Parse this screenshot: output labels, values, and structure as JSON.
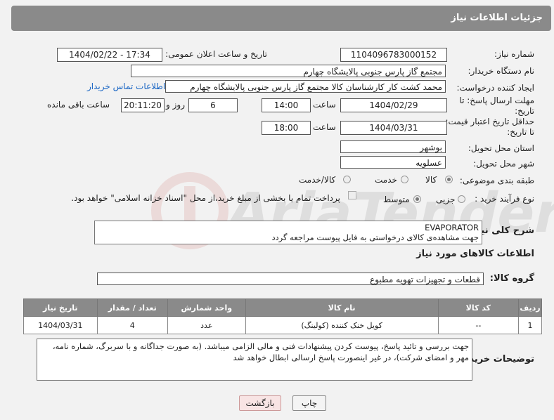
{
  "header": {
    "title": "جزئیات اطلاعات نیاز"
  },
  "fields": {
    "need_number_label": "شماره نیاز:",
    "need_number": "1104096783000152",
    "announce_label": "تاریخ و ساعت اعلان عمومی:",
    "announce_value": "1404/02/22 - 17:34",
    "buyer_org_label": "نام دستگاه خریدار:",
    "buyer_org": "مجتمع گاز پارس جنوبی  پالایشگاه چهارم",
    "requester_label": "ایجاد کننده درخواست:",
    "requester": "محمد کشت کار کارشناسان کالا مجتمع گاز پارس جنوبی  پالایشگاه چهارم",
    "contact_link": "اطلاعات تماس خریدار",
    "reply_deadline_label": "مهلت ارسال پاسخ: تا تاریخ:",
    "reply_date": "1404/02/29",
    "time_label": "ساعت",
    "reply_time": "14:00",
    "days": "6",
    "days_label": "روز و",
    "remaining": "20:11:20",
    "remaining_label": "ساعت باقی مانده",
    "price_validity_label": "حداقل تاریخ اعتبار قیمت: تا تاریخ:",
    "validity_date": "1404/03/31",
    "validity_time": "18:00",
    "province_label": "استان محل تحویل:",
    "province": "بوشهر",
    "city_label": "شهر محل تحویل:",
    "city": "عسلویه",
    "category_label": "طبقه بندی موضوعی:",
    "category_options": [
      "کالا",
      "خدمت",
      "کالا/خدمت"
    ],
    "purchase_type_label": "نوع فرآیند خرید :",
    "purchase_options": [
      "جزیی",
      "متوسط"
    ],
    "payment_note": "پرداخت تمام یا بخشی از مبلغ خرید،از محل \"اسناد خزانه اسلامی\" خواهد بود."
  },
  "description": {
    "label": "شرح کلی نیاز:",
    "line1": "EVAPORATOR",
    "line2": "جهت مشاهده‌ی کالای درخواستی به فایل پیوست مراجعه گردد"
  },
  "goods_info": {
    "title": "اطلاعات کالاهای مورد نیاز"
  },
  "goods_group": {
    "label": "گروه کالا:",
    "value": "قطعات و تجهیزات تهویه مطبوع"
  },
  "table": {
    "headers": [
      "ردیف",
      "کد کالا",
      "نام کالا",
      "واحد شمارش",
      "تعداد / مقدار",
      "تاریخ نیاز"
    ],
    "rows": [
      [
        "1",
        "--",
        "کویل خنک کننده (کولینگ)",
        "عدد",
        "4",
        "1404/03/31"
      ]
    ]
  },
  "buyer_notes": {
    "label": "توضیحات خریدار:",
    "text": "جهت بررسی و تائید پاسخ، پیوست کردن پیشنهادات فنی و مالی الزامی میباشد. (به صورت جداگانه و با سربرگ، شماره نامه، مهر و امضای شرکت)، در غیر اینصورت پاسخ ارسالی ابطال خواهد شد"
  },
  "buttons": {
    "print": "چاپ",
    "back": "بازگشت"
  }
}
